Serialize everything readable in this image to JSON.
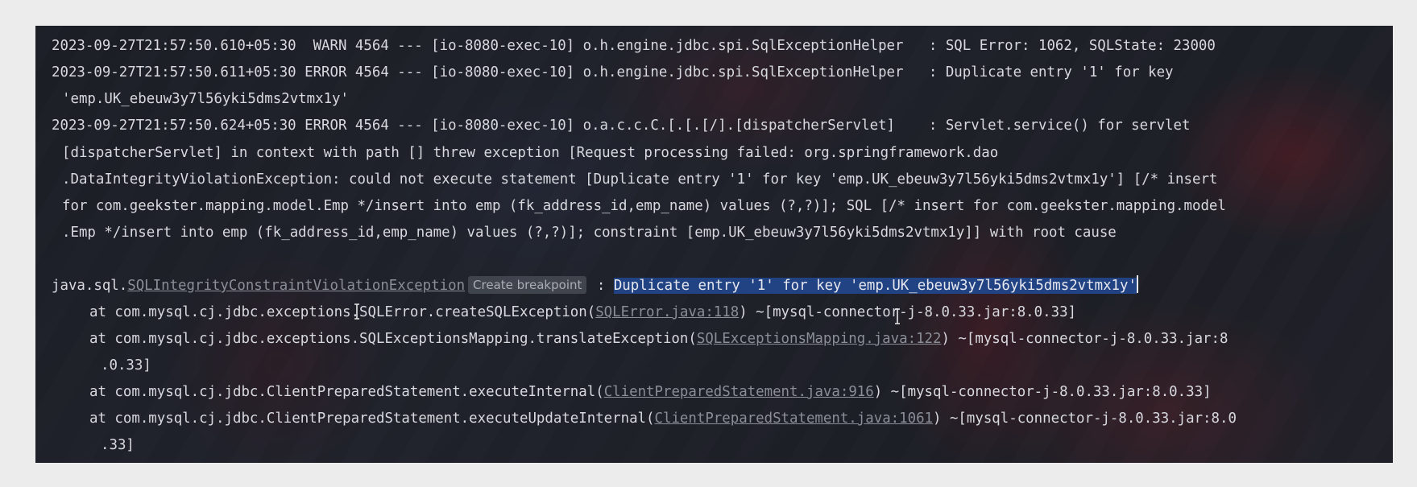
{
  "log": {
    "l1": "2023-09-27T21:57:50.610+05:30  WARN 4564 --- [io-8080-exec-10] o.h.engine.jdbc.spi.SqlExceptionHelper   : SQL Error: 1062, SQLState: 23000",
    "l2": "2023-09-27T21:57:50.611+05:30 ERROR 4564 --- [io-8080-exec-10] o.h.engine.jdbc.spi.SqlExceptionHelper   : Duplicate entry '1' for key",
    "l3": "'emp.UK_ebeuw3y7l56yki5dms2vtmx1y'",
    "l4": "2023-09-27T21:57:50.624+05:30 ERROR 4564 --- [io-8080-exec-10] o.a.c.c.C.[.[.[/].[dispatcherServlet]    : Servlet.service() for servlet",
    "l5": "[dispatcherServlet] in context with path [] threw exception [Request processing failed: org.springframework.dao",
    "l6": ".DataIntegrityViolationException: could not execute statement [Duplicate entry '1' for key 'emp.UK_ebeuw3y7l56yki5dms2vtmx1y'] [/* insert",
    "l7": "for com.geekster.mapping.model.Emp */insert into emp (fk_address_id,emp_name) values (?,?)]; SQL [/* insert for com.geekster.mapping.model",
    "l8": ".Emp */insert into emp (fk_address_id,emp_name) values (?,?)]; constraint [emp.UK_ebeuw3y7l56yki5dms2vtmx1y]] with root cause"
  },
  "exception": {
    "prefix": "java.sql.",
    "class_link": "SQLIntegrityConstraintViolationException",
    "breakpoint_label": "Create breakpoint",
    "separator": " : ",
    "message": "Duplicate entry '1' for key 'emp.UK_ebeuw3y7l56yki5dms2vtmx1y'"
  },
  "stack": [
    {
      "pre": "at com.mysql.cj.jdbc.exceptions.SQLError.createSQLException(",
      "link": "SQLError.java:118",
      "post": ") ~[mysql-connector-j-8.0.33.jar:8.0.33]"
    },
    {
      "pre": "at com.mysql.cj.jdbc.exceptions.SQLExceptionsMapping.translateException(",
      "link": "SQLExceptionsMapping.java:122",
      "post": ") ~[mysql-connector-j-8.0.33.jar:8",
      "cont": ".0.33]"
    },
    {
      "pre": "at com.mysql.cj.jdbc.ClientPreparedStatement.executeInternal(",
      "link": "ClientPreparedStatement.java:916",
      "post": ") ~[mysql-connector-j-8.0.33.jar:8.0.33]"
    },
    {
      "pre": "at com.mysql.cj.jdbc.ClientPreparedStatement.executeUpdateInternal(",
      "link": "ClientPreparedStatement.java:1061",
      "post": ") ~[mysql-connector-j-8.0.33.jar:8.0",
      "cont": ".33]"
    }
  ],
  "colors": {
    "text": "#d7d9de",
    "link": "#8b8e96",
    "selection": "#214283"
  },
  "icons": [
    "text-cursor-icon"
  ]
}
